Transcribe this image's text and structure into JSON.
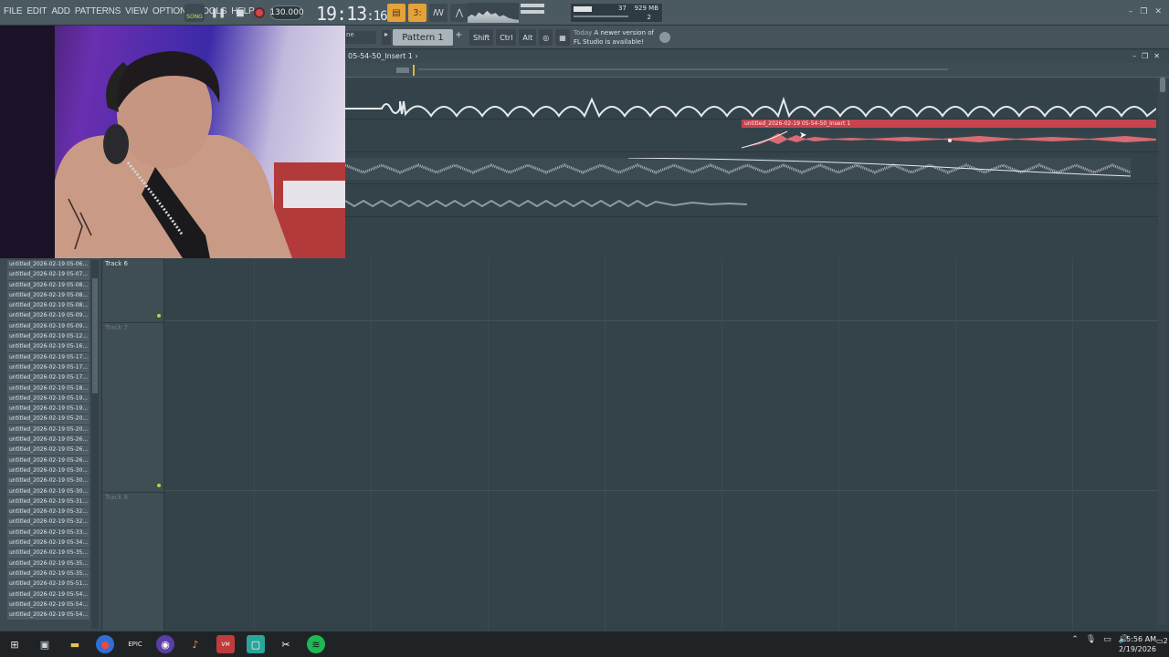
{
  "menu": [
    "FILE",
    "EDIT",
    "ADD",
    "PATTERNS",
    "VIEW",
    "OPTIONS",
    "TOOLS",
    "HELP"
  ],
  "transport": {
    "song_label": "SONG",
    "tempo": "130.000",
    "time_main": "19:13",
    "time_sub": ":16"
  },
  "monitor": {
    "polyphony": "37",
    "memory": "929 MB",
    "count": "2"
  },
  "toolbar2": {
    "mode": "ne",
    "pattern": "Pattern 1",
    "keys": [
      "Shift",
      "Ctrl",
      "Alt"
    ],
    "news_day": "Today",
    "news_line1": "A newer version of",
    "news_line2": "FL Studio is available!"
  },
  "playlist": {
    "title": "05-54-50_Insert 1",
    "clip_label": "untitled_2026-02-19 05-54-50_Insert 1",
    "tracks": [
      "Track 6",
      "Track 7",
      "Track 8"
    ]
  },
  "browser": {
    "items": [
      "untitled_2026-02-19 05-06...",
      "untitled_2026-02-19 05-07...",
      "untitled_2026-02-19 05-08...",
      "untitled_2026-02-19 05-08...",
      "untitled_2026-02-19 05-08...",
      "untitled_2026-02-19 05-09...",
      "untitled_2026-02-19 05-09...",
      "untitled_2026-02-19 05-12...",
      "untitled_2026-02-19 05-16...",
      "untitled_2026-02-19 05-17...",
      "untitled_2026-02-19 05-17...",
      "untitled_2026-02-19 05-17...",
      "untitled_2026-02-19 05-18...",
      "untitled_2026-02-19 05-19...",
      "untitled_2026-02-19 05-19...",
      "untitled_2026-02-19 05-20...",
      "untitled_2026-02-19 05-20...",
      "untitled_2026-02-19 05-26...",
      "untitled_2026-02-19 05-26...",
      "untitled_2026-02-19 05-26...",
      "untitled_2026-02-19 05-30...",
      "untitled_2026-02-19 05-30...",
      "untitled_2026-02-19 05-30...",
      "untitled_2026-02-19 05-31...",
      "untitled_2026-02-19 05-32...",
      "untitled_2026-02-19 05-32...",
      "untitled_2026-02-19 05-33...",
      "untitled_2026-02-19 05-34...",
      "untitled_2026-02-19 05-35...",
      "untitled_2026-02-19 05-35...",
      "untitled_2026-02-19 05-35...",
      "untitled_2026-02-19 05-51...",
      "untitled_2026-02-19 05-54...",
      "untitled_2026-02-19 05-54...",
      "untitled_2026-02-19 05-54..."
    ]
  },
  "taskbar": {
    "apps": [
      "windows-icon",
      "file-explorer-icon",
      "folder-icon",
      "chrome-icon",
      "epic-games-icon",
      "obs-icon",
      "fl-studio-icon",
      "voicemeeter-icon",
      "app-icon",
      "capcut-icon",
      "spotify-icon"
    ],
    "time": "5:56 AM",
    "date": "2/19/2026",
    "notifications": "2"
  },
  "colors": {
    "clip_red": "#c7434e",
    "accent_orange": "#e3a23a",
    "led_green": "#9cdc5b"
  }
}
